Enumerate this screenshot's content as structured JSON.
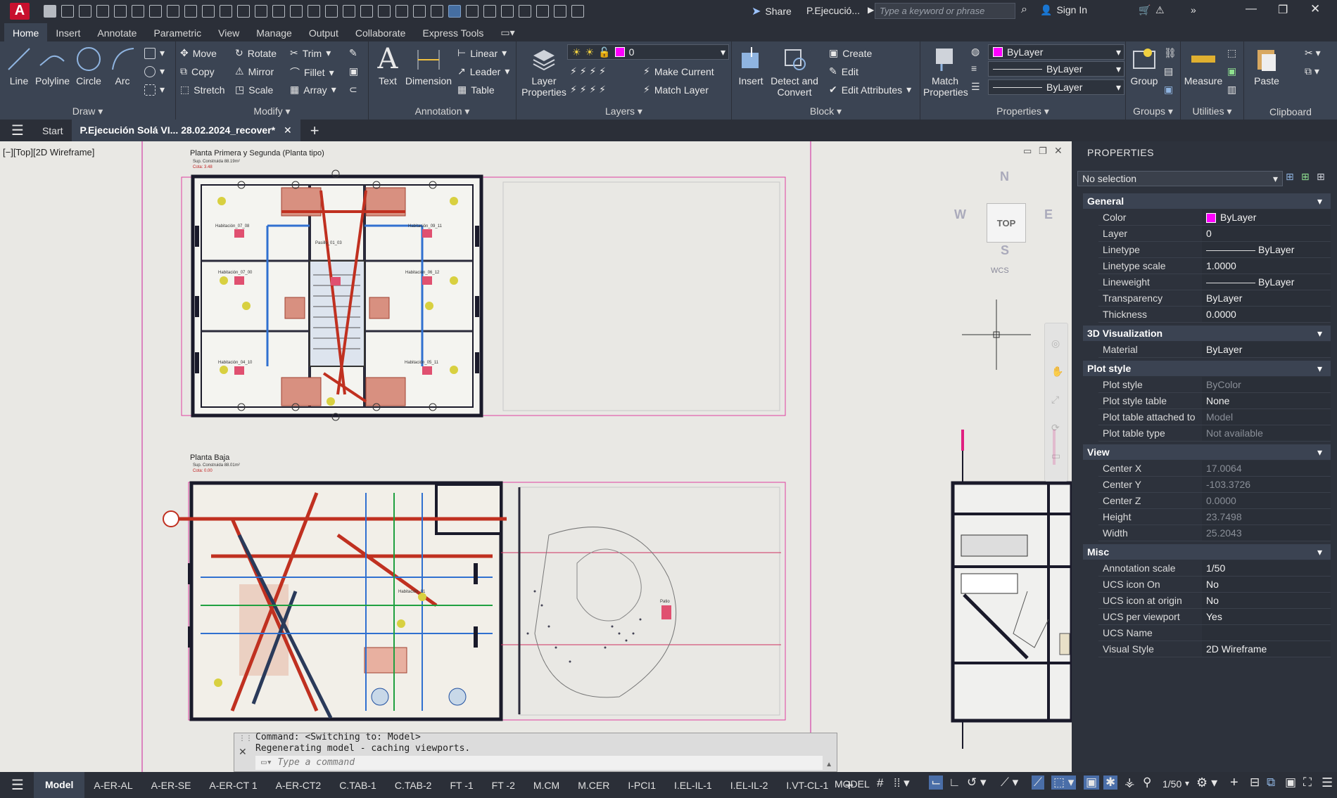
{
  "titlebar": {
    "share": "Share",
    "doc_title": "P.Ejecució...",
    "search_placeholder": "Type a keyword or phrase",
    "sign_in": "Sign In"
  },
  "ribbon_tabs": [
    "Home",
    "Insert",
    "Annotate",
    "Parametric",
    "View",
    "Manage",
    "Output",
    "Collaborate",
    "Express Tools"
  ],
  "ribbon": {
    "draw": {
      "title": "Draw",
      "line": "Line",
      "polyline": "Polyline",
      "circle": "Circle",
      "arc": "Arc"
    },
    "modify": {
      "title": "Modify",
      "move": "Move",
      "rotate": "Rotate",
      "trim": "Trim",
      "copy": "Copy",
      "mirror": "Mirror",
      "fillet": "Fillet",
      "stretch": "Stretch",
      "scale": "Scale",
      "array": "Array"
    },
    "annotation": {
      "title": "Annotation",
      "text": "Text",
      "dimension": "Dimension",
      "linear": "Linear",
      "leader": "Leader",
      "table": "Table"
    },
    "layers": {
      "title": "Layers",
      "layer_properties": "Layer Properties",
      "current_layer": "0",
      "make_current": "Make Current",
      "match_layer": "Match Layer"
    },
    "block": {
      "title": "Block",
      "insert": "Insert",
      "detect_convert": "Detect and Convert",
      "create": "Create",
      "edit": "Edit",
      "edit_attributes": "Edit Attributes"
    },
    "properties": {
      "title": "Properties",
      "match_properties": "Match Properties",
      "color": "ByLayer",
      "linetype": "ByLayer",
      "lineweight": "ByLayer"
    },
    "groups": {
      "title": "Groups",
      "group": "Group"
    },
    "utilities": {
      "title": "Utilities",
      "measure": "Measure"
    },
    "clipboard": {
      "title": "Clipboard",
      "paste": "Paste"
    }
  },
  "file_tabs": {
    "start": "Start",
    "active": "P.Ejecución Solá  VI... 28.02.2024_recover*"
  },
  "canvas": {
    "view_label": "[−][Top][2D Wireframe]",
    "upper_plan_title": "Planta Primera y Segunda (Planta tipo)",
    "upper_plan_sub1": "Sup. Construida 88.19m²",
    "upper_plan_sub2": "Cota: 3.48",
    "lower_plan_title": "Planta Baja",
    "lower_plan_sub1": "Sup. Construida 88.01m²",
    "lower_plan_sub2": "Cota: 0.00",
    "rooms": {
      "habitacion_07": "Habitación_07_08",
      "habitacion_09": "Habitación_09_11",
      "pasillo": "Pasillo_01_03",
      "hab_02": "Habitación_07_00",
      "hab_06": "Habitación_06_12",
      "hab_04": "Habitación_04_10",
      "hab_05": "Habitación_05_11",
      "hab_01": "Habitación_01",
      "patio": "Patio"
    },
    "viewcube": {
      "n": "N",
      "s": "S",
      "e": "E",
      "w": "W",
      "top": "TOP",
      "wcs": "WCS"
    }
  },
  "command": {
    "line1": "Command:   <Switching to: Model>",
    "line2": "Regenerating model - caching viewports.",
    "placeholder": "Type a command"
  },
  "properties_panel": {
    "header": "PROPERTIES",
    "selection": "No selection",
    "sections": {
      "general": {
        "title": "General",
        "rows": [
          [
            "Color",
            "ByLayer"
          ],
          [
            "Layer",
            "0"
          ],
          [
            "Linetype",
            "ByLayer"
          ],
          [
            "Linetype scale",
            "1.0000"
          ],
          [
            "Lineweight",
            "ByLayer"
          ],
          [
            "Transparency",
            "ByLayer"
          ],
          [
            "Thickness",
            "0.0000"
          ]
        ]
      },
      "viz": {
        "title": "3D Visualization",
        "rows": [
          [
            "Material",
            "ByLayer"
          ]
        ]
      },
      "plot": {
        "title": "Plot style",
        "rows": [
          [
            "Plot style",
            "ByColor"
          ],
          [
            "Plot style table",
            "None"
          ],
          [
            "Plot table attached to",
            "Model"
          ],
          [
            "Plot table type",
            "Not available"
          ]
        ]
      },
      "view": {
        "title": "View",
        "rows": [
          [
            "Center X",
            "17.0064"
          ],
          [
            "Center Y",
            "-103.3726"
          ],
          [
            "Center Z",
            "0.0000"
          ],
          [
            "Height",
            "23.7498"
          ],
          [
            "Width",
            "25.2043"
          ]
        ]
      },
      "misc": {
        "title": "Misc",
        "rows": [
          [
            "Annotation scale",
            "1/50"
          ],
          [
            "UCS icon On",
            "No"
          ],
          [
            "UCS icon at origin",
            "No"
          ],
          [
            "UCS per viewport",
            "Yes"
          ],
          [
            "UCS Name",
            ""
          ],
          [
            "Visual Style",
            "2D Wireframe"
          ]
        ]
      }
    }
  },
  "layout_tabs": [
    "Model",
    "A-ER-AL",
    "A-ER-SE",
    "A-ER-CT 1",
    "A-ER-CT2",
    "C.TAB-1",
    "C.TAB-2",
    "FT -1",
    "FT -2",
    "M.CM",
    "M.CER",
    "I-PCI1",
    "I.EL-IL-1",
    "I.EL-IL-2",
    "I.VT-CL-1"
  ],
  "status": {
    "model": "MODEL",
    "scale": "1/50"
  },
  "colors": {
    "accent": "#3b4453",
    "magenta": "#ff00ff",
    "canvas": "#e9e8e4"
  }
}
